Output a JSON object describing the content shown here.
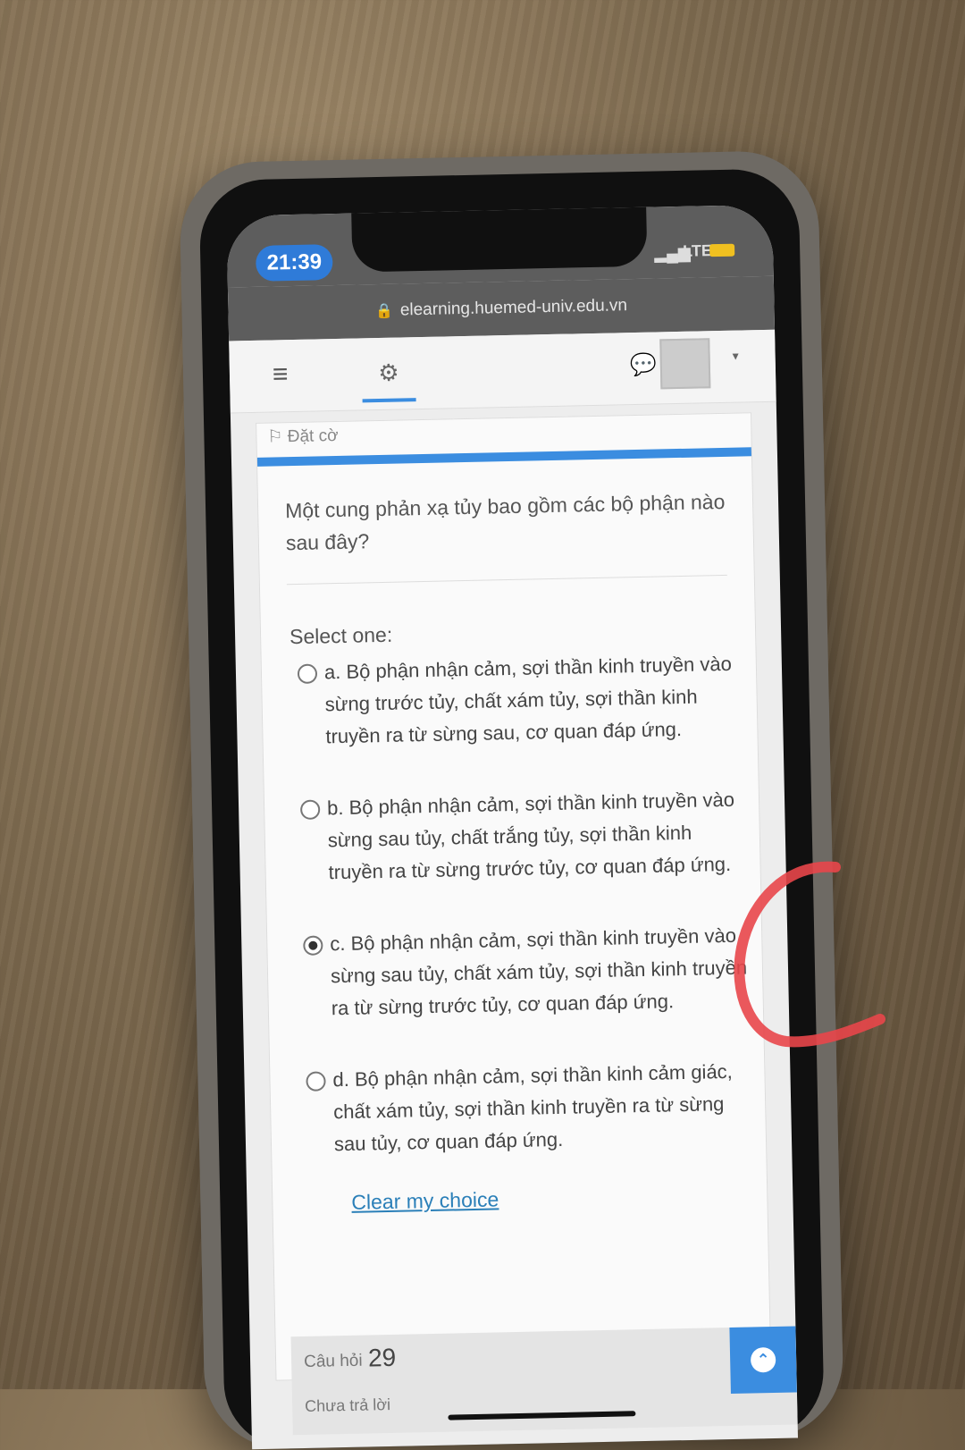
{
  "status": {
    "time": "21:39",
    "network": "LTE"
  },
  "browser": {
    "url": "elearning.huemed-univ.edu.vn"
  },
  "quiz": {
    "flag_label": "Đặt cờ",
    "question": "Một cung phản xạ tủy bao gồm các bộ phận nào sau đây?",
    "select_label": "Select one:",
    "options": [
      {
        "label": "a. Bộ phận nhận cảm, sợi thần kinh truyền vào sừng trước tủy, chất xám tủy, sợi thần kinh truyền ra từ sừng sau, cơ quan đáp ứng.",
        "selected": false
      },
      {
        "label": "b. Bộ phận nhận cảm, sợi thần kinh truyền vào sừng sau tủy, chất trắng tủy, sợi thần kinh truyền ra từ sừng trước tủy, cơ quan đáp ứng.",
        "selected": false
      },
      {
        "label": "c. Bộ phận nhận cảm, sợi thần kinh truyền vào sừng sau tủy, chất xám tủy, sợi thần kinh truyền ra từ sừng trước tủy, cơ quan đáp ứng.",
        "selected": true
      },
      {
        "label": "d. Bộ phận nhận cảm, sợi thần kinh cảm giác, chất xám tủy, sợi thần kinh truyền ra từ sừng sau tủy, cơ quan đáp ứng.",
        "selected": false
      }
    ],
    "clear_label": "Clear my choice",
    "question_label": "Câu hỏi",
    "question_number": "29",
    "question_status": "Chưa trả lời"
  },
  "colors": {
    "accent": "#3b8de0",
    "mark": "#e8464a"
  }
}
